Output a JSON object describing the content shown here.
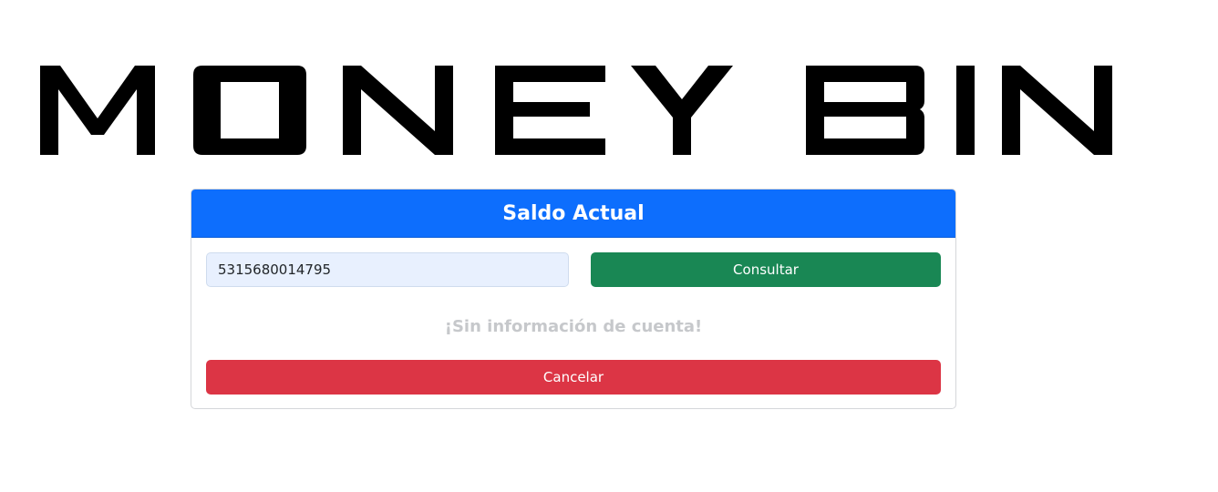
{
  "logo": {
    "text": "MONEY BIN",
    "color": "#000000"
  },
  "card": {
    "header_title": "Saldo Actual",
    "header_color": "#0d6efd",
    "account_input": {
      "value": "5315680014795",
      "placeholder": ""
    },
    "consult_button_label": "Consultar",
    "consult_button_color": "#198754",
    "no_info_message": "¡Sin información de cuenta!",
    "cancel_button_label": "Cancelar",
    "cancel_button_color": "#dc3545"
  }
}
